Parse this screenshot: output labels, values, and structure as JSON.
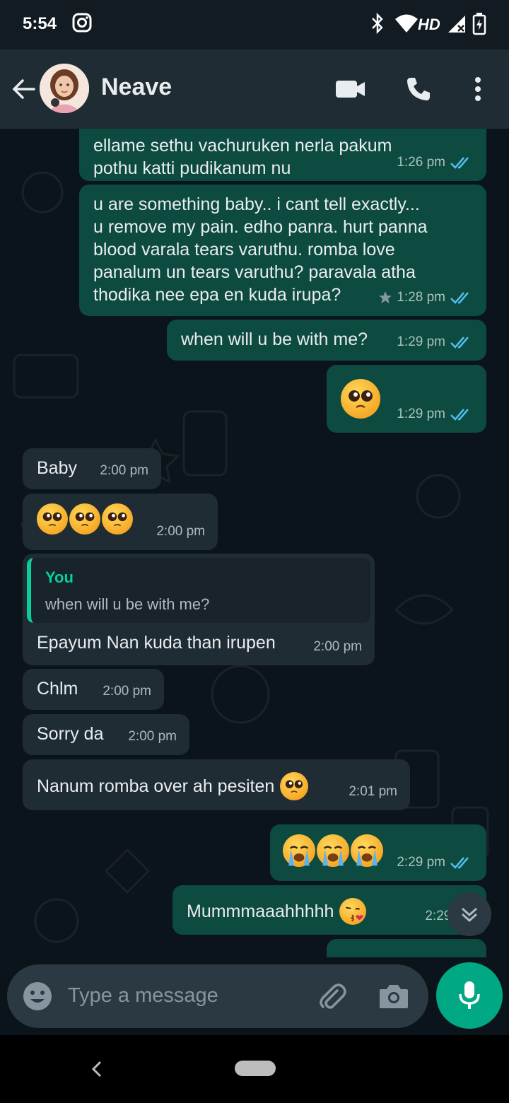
{
  "status_bar": {
    "time": "5:54",
    "network_label": "HD",
    "icons": [
      "instagram-icon",
      "bluetooth-icon",
      "wifi-icon",
      "signal-icon",
      "battery-icon"
    ]
  },
  "header": {
    "contact_name": "Neave",
    "icons": [
      "back-arrow-icon",
      "video-call-icon",
      "phone-icon",
      "more-vert-icon"
    ]
  },
  "messages": [
    {
      "direction": "out",
      "text": "ellame sethu vachuruken nerla pakum\npothu katti pudikanum nu",
      "time": "1:26 pm"
    },
    {
      "direction": "out",
      "text": "u are something baby.. i cant tell exactly...\nu remove my pain. edho panra. hurt panna\nblood varala tears varuthu. romba love\npanalum un tears varuthu? paravala atha\nthodika nee epa en kuda irupa?",
      "time": "1:28 pm",
      "starred": true
    },
    {
      "direction": "out",
      "text": "when will u be with me?",
      "time": "1:29 pm"
    },
    {
      "direction": "out",
      "emoji": "pleading-face",
      "time": "1:29 pm"
    },
    {
      "direction": "in",
      "text": "Baby",
      "time": "2:00 pm"
    },
    {
      "direction": "in",
      "emoji": "pleading-face x3",
      "time": "2:00 pm"
    },
    {
      "direction": "in",
      "quote_author": "You",
      "quote_text": "when will u be with me?",
      "text": "Epayum Nan kuda than irupen",
      "time": "2:00 pm"
    },
    {
      "direction": "in",
      "text": "Chlm",
      "time": "2:00 pm"
    },
    {
      "direction": "in",
      "text": "Sorry da",
      "time": "2:00 pm"
    },
    {
      "direction": "in",
      "text": "Nanum romba over ah pesiten",
      "time": "2:01 pm"
    },
    {
      "direction": "out",
      "emoji": "crying-face x3",
      "time": "2:29 pm"
    },
    {
      "direction": "out",
      "text": "Mummmaaahhhhh",
      "time": "2:29 pm"
    }
  ],
  "input": {
    "placeholder": "Type a message"
  },
  "colors": {
    "accent": "#00a884",
    "outgoing_bubble": "#0d4a40",
    "incoming_bubble": "#1f2c33",
    "header": "#202c33",
    "background": "#0b141a",
    "read_tick": "#53bdeb"
  }
}
